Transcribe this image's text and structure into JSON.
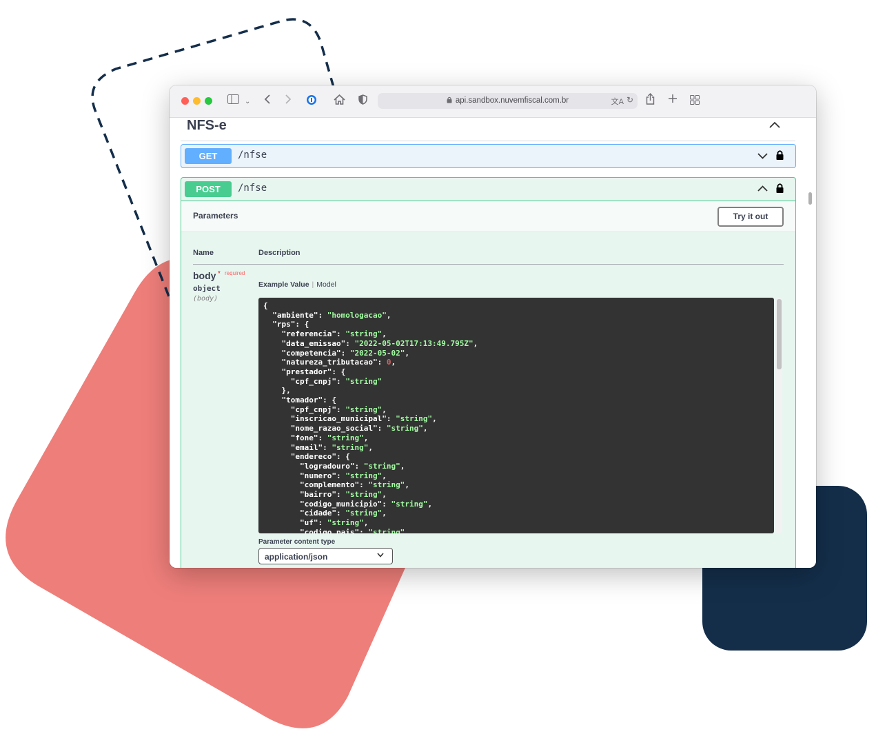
{
  "browser": {
    "url": "api.sandbox.nuvemfiscal.com.br",
    "icons": [
      "sidebar-icon",
      "chevron-down-icon",
      "back-icon",
      "forward-icon",
      "password-manager-icon",
      "home-icon",
      "shield-icon",
      "translate-icon",
      "reload-icon",
      "share-icon",
      "new-tab-icon",
      "tab-overview-icon"
    ]
  },
  "section": {
    "title": "NFS-e"
  },
  "operations": [
    {
      "method": "GET",
      "path": "/nfse",
      "color": "#61affe"
    },
    {
      "method": "POST",
      "path": "/nfse",
      "color": "#49cc90"
    }
  ],
  "parameters": {
    "heading": "Parameters",
    "try_button": "Try it out",
    "col_name": "Name",
    "col_description": "Description",
    "body": {
      "name": "body",
      "required_star": "*",
      "required_label": "required",
      "type": "object",
      "location": "(body)"
    },
    "tabs": {
      "example": "Example Value",
      "separator": "|",
      "model": "Model"
    },
    "content_type_label": "Parameter content type",
    "content_type_value": "application/json"
  },
  "example_json": [
    {
      "indent": 0,
      "text": "{"
    },
    {
      "indent": 1,
      "key": "ambiente",
      "value": "homologacao",
      "vtype": "s",
      "comma": true
    },
    {
      "indent": 1,
      "key": "rps",
      "open": "{"
    },
    {
      "indent": 2,
      "key": "referencia",
      "value": "string",
      "vtype": "s",
      "comma": true
    },
    {
      "indent": 2,
      "key": "data_emissao",
      "value": "2022-05-02T17:13:49.795Z",
      "vtype": "s",
      "comma": true
    },
    {
      "indent": 2,
      "key": "competencia",
      "value": "2022-05-02",
      "vtype": "s",
      "comma": true
    },
    {
      "indent": 2,
      "key": "natureza_tributacao",
      "value": "0",
      "vtype": "n",
      "comma": true
    },
    {
      "indent": 2,
      "key": "prestador",
      "open": "{"
    },
    {
      "indent": 3,
      "key": "cpf_cnpj",
      "value": "string",
      "vtype": "s",
      "comma": false
    },
    {
      "indent": 2,
      "text": "},"
    },
    {
      "indent": 2,
      "key": "tomador",
      "open": "{"
    },
    {
      "indent": 3,
      "key": "cpf_cnpj",
      "value": "string",
      "vtype": "s",
      "comma": true
    },
    {
      "indent": 3,
      "key": "inscricao_municipal",
      "value": "string",
      "vtype": "s",
      "comma": true
    },
    {
      "indent": 3,
      "key": "nome_razao_social",
      "value": "string",
      "vtype": "s",
      "comma": true
    },
    {
      "indent": 3,
      "key": "fone",
      "value": "string",
      "vtype": "s",
      "comma": true
    },
    {
      "indent": 3,
      "key": "email",
      "value": "string",
      "vtype": "s",
      "comma": true
    },
    {
      "indent": 3,
      "key": "endereco",
      "open": "{"
    },
    {
      "indent": 4,
      "key": "logradouro",
      "value": "string",
      "vtype": "s",
      "comma": true
    },
    {
      "indent": 4,
      "key": "numero",
      "value": "string",
      "vtype": "s",
      "comma": true
    },
    {
      "indent": 4,
      "key": "complemento",
      "value": "string",
      "vtype": "s",
      "comma": true
    },
    {
      "indent": 4,
      "key": "bairro",
      "value": "string",
      "vtype": "s",
      "comma": true
    },
    {
      "indent": 4,
      "key": "codigo_municipio",
      "value": "string",
      "vtype": "s",
      "comma": true
    },
    {
      "indent": 4,
      "key": "cidade",
      "value": "string",
      "vtype": "s",
      "comma": true
    },
    {
      "indent": 4,
      "key": "uf",
      "value": "string",
      "vtype": "s",
      "comma": true
    },
    {
      "indent": 4,
      "key": "codigo_pais",
      "value": "string",
      "vtype": "s",
      "comma": true
    }
  ],
  "colors": {
    "get": "#61affe",
    "post": "#49cc90",
    "deco_red": "#ee7e7a",
    "deco_navy": "#142e4a",
    "deco_dash": "#142e4a"
  }
}
